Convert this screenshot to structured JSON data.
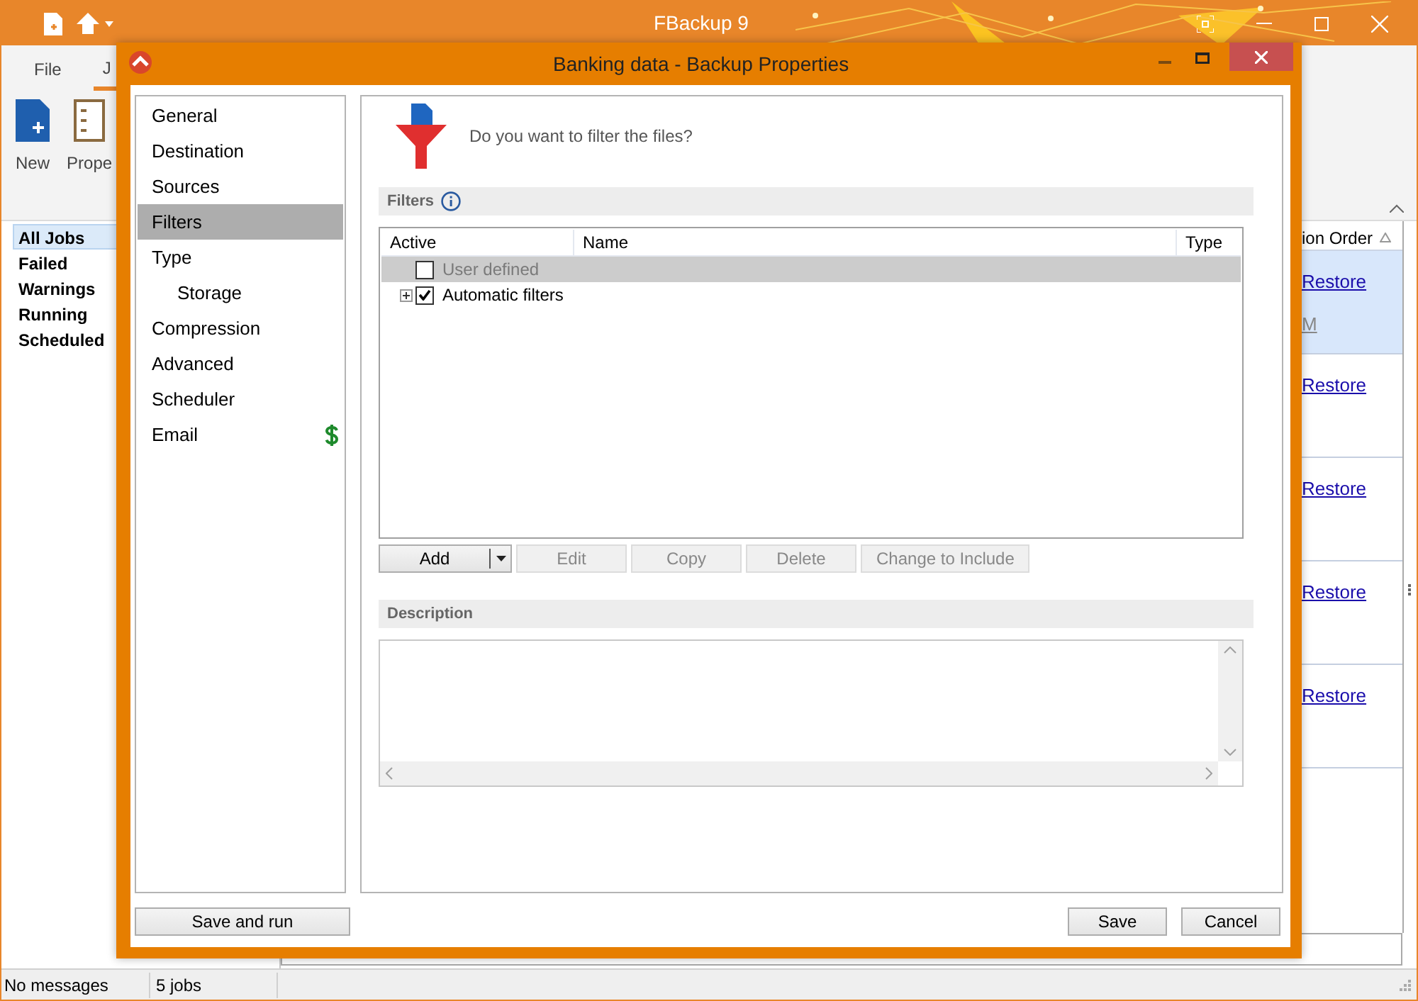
{
  "main_window": {
    "title": "FBackup 9",
    "ribbon_tabs": [
      {
        "label": "File",
        "selected": false
      },
      {
        "label": "J",
        "selected": true
      }
    ],
    "ribbon_buttons": [
      "New",
      "Prope"
    ],
    "job_filters": [
      {
        "label": "All Jobs",
        "selected": true
      },
      {
        "label": "Failed",
        "selected": false
      },
      {
        "label": "Warnings",
        "selected": false
      },
      {
        "label": "Running",
        "selected": false
      },
      {
        "label": "Scheduled",
        "selected": false
      }
    ],
    "jobs_table": {
      "column_header": "ion Order",
      "rows": [
        {
          "link": "Restore",
          "detail": "M",
          "selected": true
        },
        {
          "link": "Restore",
          "selected": false
        },
        {
          "link": "Restore",
          "selected": false
        },
        {
          "link": "Restore",
          "selected": false
        },
        {
          "link": "Restore",
          "selected": false
        }
      ]
    },
    "status_bar": [
      "No messages",
      "5 jobs"
    ]
  },
  "dialog": {
    "title": "Banking data - Backup Properties",
    "nav_items": [
      {
        "label": "General",
        "selected": false,
        "paid": false
      },
      {
        "label": "Destination",
        "selected": false,
        "paid": false
      },
      {
        "label": "Sources",
        "selected": false,
        "paid": false
      },
      {
        "label": "Filters",
        "selected": true,
        "paid": false
      },
      {
        "label": "Type",
        "selected": false,
        "paid": false,
        "children": [
          {
            "label": "Storage",
            "selected": false,
            "paid": false
          }
        ]
      },
      {
        "label": "Compression",
        "selected": false,
        "paid": false
      },
      {
        "label": "Advanced",
        "selected": false,
        "paid": false
      },
      {
        "label": "Scheduler",
        "selected": false,
        "paid": false
      },
      {
        "label": "Email",
        "selected": false,
        "paid": true
      }
    ],
    "question": "Do you want to filter the files?",
    "filters_heading": "Filters",
    "filters_table": {
      "columns": [
        "Active",
        "Name",
        "Type"
      ],
      "rows": [
        {
          "name": "User defined",
          "checked": false,
          "disabled": true,
          "selected": true,
          "expandable": false
        },
        {
          "name": "Automatic filters",
          "checked": true,
          "disabled": false,
          "selected": false,
          "expandable": true
        }
      ]
    },
    "filter_buttons": [
      {
        "label": "Add",
        "kind": "split",
        "disabled": false
      },
      {
        "label": "Edit",
        "kind": "plain",
        "disabled": true
      },
      {
        "label": "Copy",
        "kind": "plain",
        "disabled": true
      },
      {
        "label": "Delete",
        "kind": "plain",
        "disabled": true
      },
      {
        "label": "Change to Include",
        "kind": "plain",
        "disabled": true
      }
    ],
    "description_heading": "Description",
    "footer_buttons": {
      "left": "Save and run",
      "right": [
        "Save",
        "Cancel"
      ]
    }
  }
}
